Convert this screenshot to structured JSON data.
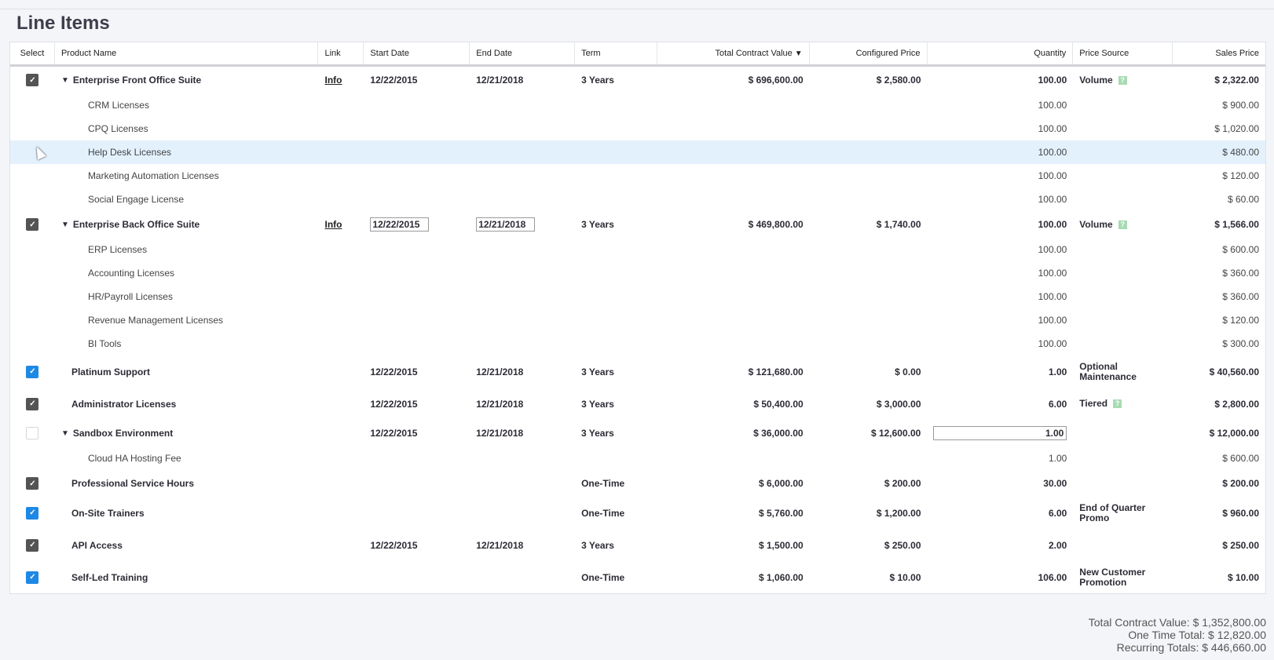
{
  "title": "Line Items",
  "columns": [
    "Select",
    "Product Name",
    "Link",
    "Start Date",
    "End Date",
    "Term",
    "Total Contract Value",
    "Configured Price",
    "Quantity",
    "Price Source",
    "Sales Price"
  ],
  "sort_icon": "triangle-down-icon",
  "rows": [
    {
      "type": "parent",
      "check": "dark",
      "expand": true,
      "name": "Enterprise Front Office Suite",
      "link": "Info",
      "start": "12/22/2015",
      "end": "12/21/2018",
      "term": "3 Years",
      "tcv": "$ 696,600.00",
      "cfg": "$ 2,580.00",
      "qty": "100.00",
      "src": "Volume",
      "help": true,
      "sales": "$ 2,322.00"
    },
    {
      "type": "child",
      "name": "CRM Licenses",
      "qty": "100.00",
      "sales": "$ 900.00"
    },
    {
      "type": "child",
      "name": "CPQ Licenses",
      "qty": "100.00",
      "sales": "$ 1,020.00"
    },
    {
      "type": "child",
      "name": "Help Desk Licenses",
      "qty": "100.00",
      "sales": "$ 480.00",
      "hl": true
    },
    {
      "type": "child",
      "name": "Marketing Automation Licenses",
      "qty": "100.00",
      "sales": "$ 120.00"
    },
    {
      "type": "child",
      "name": "Social Engage License",
      "qty": "100.00",
      "sales": "$ 60.00"
    },
    {
      "type": "parent",
      "check": "dark",
      "expand": true,
      "name": "Enterprise Back Office Suite",
      "link": "Info",
      "start": "12/22/2015",
      "end": "12/21/2018",
      "dateEdit": true,
      "term": "3 Years",
      "tcv": "$ 469,800.00",
      "cfg": "$ 1,740.00",
      "qty": "100.00",
      "src": "Volume",
      "help": true,
      "sales": "$ 1,566.00"
    },
    {
      "type": "child",
      "name": "ERP Licenses",
      "qty": "100.00",
      "sales": "$ 600.00"
    },
    {
      "type": "child",
      "name": "Accounting Licenses",
      "qty": "100.00",
      "sales": "$ 360.00"
    },
    {
      "type": "child",
      "name": "HR/Payroll Licenses",
      "qty": "100.00",
      "sales": "$ 360.00"
    },
    {
      "type": "child",
      "name": "Revenue Management Licenses",
      "qty": "100.00",
      "sales": "$ 120.00"
    },
    {
      "type": "child",
      "name": "BI Tools",
      "qty": "100.00",
      "sales": "$ 300.00"
    },
    {
      "type": "tall",
      "check": "blue",
      "name": "Platinum Support",
      "start": "12/22/2015",
      "end": "12/21/2018",
      "term": "3 Years",
      "tcv": "$ 121,680.00",
      "cfg": "$ 0.00",
      "qty": "1.00",
      "src": "Optional Maintenance",
      "sales": "$ 40,560.00"
    },
    {
      "type": "tall",
      "check": "dark",
      "name": "Administrator Licenses",
      "start": "12/22/2015",
      "end": "12/21/2018",
      "term": "3 Years",
      "tcv": "$ 50,400.00",
      "cfg": "$ 3,000.00",
      "qty": "6.00",
      "src": "Tiered",
      "help": true,
      "sales": "$ 2,800.00"
    },
    {
      "type": "parent",
      "check": "empty",
      "expand": true,
      "name": "Sandbox Environment",
      "start": "12/22/2015",
      "end": "12/21/2018",
      "term": "3 Years",
      "tcv": "$ 36,000.00",
      "cfg": "$ 12,600.00",
      "qty": "1.00",
      "qtyEdit": true,
      "sales": "$ 12,000.00"
    },
    {
      "type": "child",
      "name": "Cloud HA Hosting Fee",
      "qty": "1.00",
      "sales": "$ 600.00"
    },
    {
      "type": "parent",
      "check": "dark",
      "name": "Professional Service Hours",
      "term": "One-Time",
      "tcv": "$ 6,000.00",
      "cfg": "$ 200.00",
      "qty": "30.00",
      "sales": "$ 200.00"
    },
    {
      "type": "tall",
      "check": "blue",
      "name": "On-Site Trainers",
      "term": "One-Time",
      "tcv": "$ 5,760.00",
      "cfg": "$ 1,200.00",
      "qty": "6.00",
      "src": "End of Quarter Promo",
      "sales": "$ 960.00"
    },
    {
      "type": "tall",
      "check": "dark",
      "name": "API Access",
      "start": "12/22/2015",
      "end": "12/21/2018",
      "term": "3 Years",
      "tcv": "$ 1,500.00",
      "cfg": "$ 250.00",
      "qty": "2.00",
      "sales": "$ 250.00"
    },
    {
      "type": "tall",
      "check": "blue",
      "name": "Self-Led Training",
      "term": "One-Time",
      "tcv": "$ 1,060.00",
      "cfg": "$ 10.00",
      "qty": "106.00",
      "src": "New Customer Promotion",
      "sales": "$ 10.00"
    }
  ],
  "totals": {
    "tcv": "Total Contract Value: $ 1,352,800.00",
    "one_time": "One Time Total: $ 12,820.00",
    "recurring": "Recurring Totals: $ 446,660.00"
  }
}
